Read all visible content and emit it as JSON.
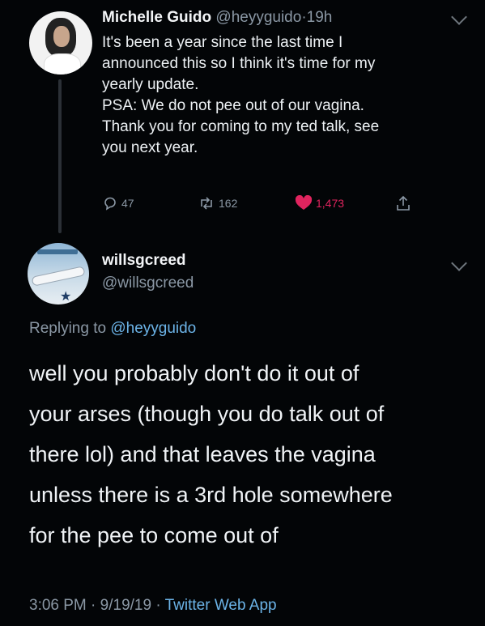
{
  "tweet": {
    "author_name": "Michelle Guido",
    "author_handle": "@heyyguido",
    "separator": "·",
    "time_ago": "19h",
    "lines": [
      "It's been a year since the last time I",
      "announced this so I think it's time for my",
      "yearly update.",
      "PSA: We do not pee out of our vagina.",
      "Thank you for coming to my ted talk, see",
      "you next year."
    ],
    "reply_count": "47",
    "retweet_count": "162",
    "like_count": "1,473",
    "icons": {
      "reply": "reply-icon",
      "retweet": "retweet-icon",
      "like": "heart-icon",
      "share": "share-icon",
      "more": "chevron-down-icon"
    },
    "colors": {
      "like": "#e0245e",
      "muted": "#8b98a5"
    }
  },
  "reply": {
    "author_name": "willsgcreed",
    "author_handle": "@willsgcreed",
    "replying_prefix": "Replying to",
    "replying_to": "@heyyguido",
    "lines": [
      "well you probably don't do it out of",
      "your arses (though you do talk out of",
      "there lol) and that leaves the vagina",
      "unless there is a 3rd hole somewhere",
      "for the pee to come out of"
    ],
    "time": "3:06 PM",
    "separator": "·",
    "date": "9/19/19",
    "app": "Twitter Web App",
    "colors": {
      "link": "#6cb4e8"
    }
  }
}
